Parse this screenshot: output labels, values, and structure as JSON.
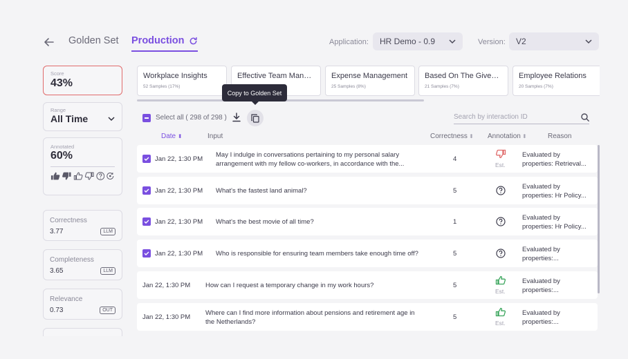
{
  "header": {
    "tabs": [
      {
        "label": "Golden Set"
      },
      {
        "label": "Production"
      }
    ],
    "application_label": "Application:",
    "application_value": "HR Demo - 0.9",
    "version_label": "Version:",
    "version_value": "V2"
  },
  "sidebar": {
    "score": {
      "caption": "Score",
      "value": "43%"
    },
    "range": {
      "caption": "Range",
      "value": "All Time"
    },
    "annotated": {
      "caption": "Annotated",
      "value": "60%"
    },
    "metrics": [
      {
        "name": "Correctness",
        "value": "3.77",
        "tag": "LLM"
      },
      {
        "name": "Completeness",
        "value": "3.65",
        "tag": "LLM"
      },
      {
        "name": "Relevance",
        "value": "0.73",
        "tag": "OUT"
      }
    ]
  },
  "categories": [
    {
      "title": "Workplace Insights",
      "samples": "52 Samples (17%)"
    },
    {
      "title": "Effective Team Manag...",
      "samples": ""
    },
    {
      "title": "Expense Management",
      "samples": "25 Samples (8%)"
    },
    {
      "title": "Based On The Given Li...",
      "samples": "21 Samples (7%)"
    },
    {
      "title": "Employee Relations",
      "samples": "20 Samples (7%)"
    }
  ],
  "tooltip": "Copy to Golden Set",
  "toolbar": {
    "select_all": "Select all ( 298 of 298 )",
    "search_placeholder": "Search by interaction ID"
  },
  "columns": {
    "date": "Date",
    "input": "Input",
    "correctness": "Correctness",
    "annotation": "Annotation",
    "reason": "Reason"
  },
  "rows": [
    {
      "checked": true,
      "date": "Jan 22, 1:30 PM",
      "input1": "May I indulge in conversations pertaining to my personal salary",
      "input2": "arrangement with my fellow co-workers, in accordance with the...",
      "correctness": "4",
      "annotation": "thumbs-down",
      "est": "Est.",
      "reason1": "Evaluated by",
      "reason2": "properties: Retrieval..."
    },
    {
      "checked": true,
      "date": "Jan 22, 1:30 PM",
      "input1": "What's the fastest land animal?",
      "input2": "",
      "correctness": "5",
      "annotation": "question",
      "est": "",
      "reason1": "Evaluated by",
      "reason2": "properties: Hr Policy..."
    },
    {
      "checked": true,
      "date": "Jan 22, 1:30 PM",
      "input1": "What's the best movie of all time?",
      "input2": "",
      "correctness": "1",
      "annotation": "question",
      "est": "",
      "reason1": "Evaluated by",
      "reason2": "properties: Hr Policy..."
    },
    {
      "checked": true,
      "date": "Jan 22, 1:30 PM",
      "input1": "Who is responsible for ensuring team members take enough time off?",
      "input2": "",
      "correctness": "5",
      "annotation": "question",
      "est": "",
      "reason1": "Evaluated by",
      "reason2": "properties:..."
    },
    {
      "checked": false,
      "date": "Jan 22, 1:30 PM",
      "input1": "How can I request a temporary change in my work hours?",
      "input2": "",
      "correctness": "5",
      "annotation": "thumbs-up",
      "est": "Est.",
      "reason1": "Evaluated by",
      "reason2": "properties:..."
    },
    {
      "checked": false,
      "date": "Jan 22, 1:30 PM",
      "input1": "Where can I find more information about pensions and retirement age in",
      "input2": "the Netherlands?",
      "correctness": "5",
      "annotation": "thumbs-up",
      "est": "Est.",
      "reason1": "Evaluated by",
      "reason2": "properties:..."
    }
  ],
  "colors": {
    "accent": "#7a4fe0",
    "danger": "#e06b6b",
    "success": "#3aa55c"
  }
}
